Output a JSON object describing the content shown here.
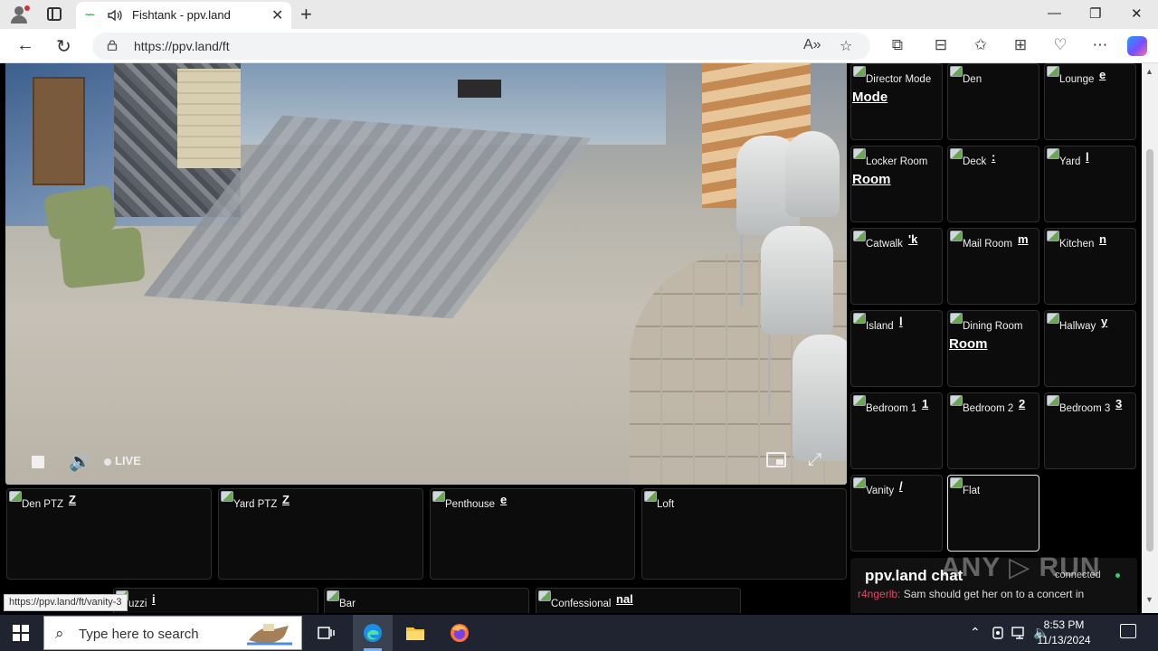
{
  "browser": {
    "tab_title": "Fishtank - ppv.land",
    "favicon_text": "~~",
    "url": "https://ppv.land/ft",
    "new_tab": "+",
    "close_tab": "✕",
    "minimize": "—",
    "restore": "❐",
    "close_window": "✕",
    "back": "←",
    "refresh": "↻",
    "read_aloud": "A»",
    "favorite": "☆",
    "extensions": "⧉",
    "split": "⊟",
    "favorites": "✩",
    "collections": "⊞",
    "performance": "♡",
    "more": "⋯"
  },
  "player": {
    "live_label": "LIVE",
    "volume_icon": "🔊",
    "fullscreen_icon": "⤢"
  },
  "side_tiles": [
    {
      "name": "Director Mode",
      "frag": "",
      "big": "Mode",
      "active": false
    },
    {
      "name": "Den",
      "frag": "",
      "big": "",
      "active": false
    },
    {
      "name": "Lounge",
      "frag": "e",
      "big": "",
      "active": false
    },
    {
      "name": "Locker Room",
      "frag": "",
      "big": "Room",
      "active": false
    },
    {
      "name": "Deck",
      "frag": ":",
      "big": "",
      "active": false
    },
    {
      "name": "Yard",
      "frag": "l",
      "big": "",
      "active": false
    },
    {
      "name": "Catwalk",
      "frag": "'k",
      "big": "",
      "active": false
    },
    {
      "name": "Mail Room",
      "frag": "m",
      "big": "",
      "active": false
    },
    {
      "name": "Kitchen",
      "frag": "n",
      "big": "",
      "active": false
    },
    {
      "name": "Island",
      "frag": "l",
      "big": "",
      "active": false
    },
    {
      "name": "Dining Room",
      "frag": "",
      "big": "Room",
      "active": false
    },
    {
      "name": "Hallway",
      "frag": "y",
      "big": "",
      "active": false
    },
    {
      "name": "Bedroom 1",
      "frag": "1",
      "big": "",
      "active": false
    },
    {
      "name": "Bedroom 2",
      "frag": "2",
      "big": "",
      "active": false
    },
    {
      "name": "Bedroom 3",
      "frag": "3",
      "big": "",
      "active": false
    },
    {
      "name": "Vanity",
      "frag": "/",
      "big": "",
      "active": false
    },
    {
      "name": "Flat",
      "frag": "",
      "big": "",
      "active": true
    }
  ],
  "bottom_tiles": [
    {
      "name": "Den PTZ",
      "frag": "Z"
    },
    {
      "name": "Yard PTZ",
      "frag": "Z"
    },
    {
      "name": "Penthouse",
      "frag": "e"
    },
    {
      "name": "Loft",
      "frag": ""
    }
  ],
  "bottom_tiles_row2": [
    {
      "name": "uzzi",
      "frag": "i"
    },
    {
      "name": "Bar",
      "frag": ""
    },
    {
      "name": "Confessional",
      "frag": "nal"
    }
  ],
  "chat": {
    "title": "ppv.land chat",
    "status": "connected",
    "message_user": "r4ngerlb:",
    "message_text": " Sam should get her on to a concert in"
  },
  "status_tip": "https://ppv.land/ft/vanity-3",
  "watermark": "ANY ▷ RUN",
  "taskbar": {
    "search_placeholder": "Type here to search",
    "time": "8:53 PM",
    "date": "11/13/2024"
  },
  "colors": {
    "accent_online": "#2fd36b",
    "chat_user": "#e04a6b",
    "taskbar_bg": "#1f2430"
  }
}
